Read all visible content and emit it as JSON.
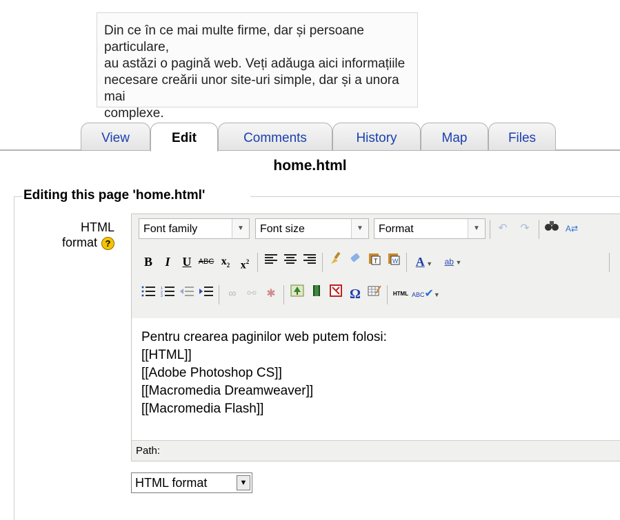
{
  "description": {
    "lines": [
      "Din ce în ce mai multe firme, dar și persoane particulare,",
      "au astăzi o pagină web. Veți adăuga aici informațiile",
      "necesare creării unor site-uri simple, dar și a unora mai",
      "complexe."
    ]
  },
  "tabs": [
    {
      "label": "View"
    },
    {
      "label": "Edit",
      "active": true
    },
    {
      "label": "Comments"
    },
    {
      "label": "History"
    },
    {
      "label": "Map"
    },
    {
      "label": "Files"
    }
  ],
  "page_title": "home.html",
  "form": {
    "legend": "Editing this page 'home.html'",
    "field_label_1": "HTML",
    "field_label_2": "format",
    "help_icon": "?"
  },
  "editor": {
    "selects": {
      "font_family": "Font family",
      "font_size": "Font size",
      "format": "Format"
    },
    "content_lines": [
      "Pentru crearea paginilor web putem folosi:",
      "[[HTML]]",
      "[[Adobe Photoshop CS]]",
      "[[Macromedia Dreamweaver]]",
      "[[Macromedia Flash]]"
    ],
    "path_label": "Path:"
  },
  "format_select": {
    "value": "HTML format"
  },
  "icons": {
    "undo": "undo-icon",
    "redo": "redo-icon",
    "find": "binoculars-icon",
    "replace": "replace-icon",
    "bold": "bold-icon",
    "italic": "italic-icon",
    "underline": "underline-icon",
    "strike": "strikethrough-icon",
    "subscript": "subscript-icon",
    "superscript": "superscript-icon",
    "align_left": "align-left-icon",
    "align_center": "align-center-icon",
    "align_right": "align-right-icon",
    "cleanup": "cleanup-brush-icon",
    "eraser": "eraser-icon",
    "paste_text": "paste-text-icon",
    "paste_word": "paste-word-icon",
    "forecolor": "text-color-icon",
    "backcolor": "highlight-color-icon",
    "bullist": "bullet-list-icon",
    "numlist": "numbered-list-icon",
    "outdent": "outdent-icon",
    "indent": "indent-icon",
    "link": "link-icon",
    "unlink": "unlink-icon",
    "anchor": "anchor-icon",
    "image": "image-icon",
    "media": "media-icon",
    "nolink": "nolink-icon",
    "charmap": "omega-icon",
    "table": "table-icon",
    "html": "html-icon",
    "spell": "spellcheck-icon"
  }
}
